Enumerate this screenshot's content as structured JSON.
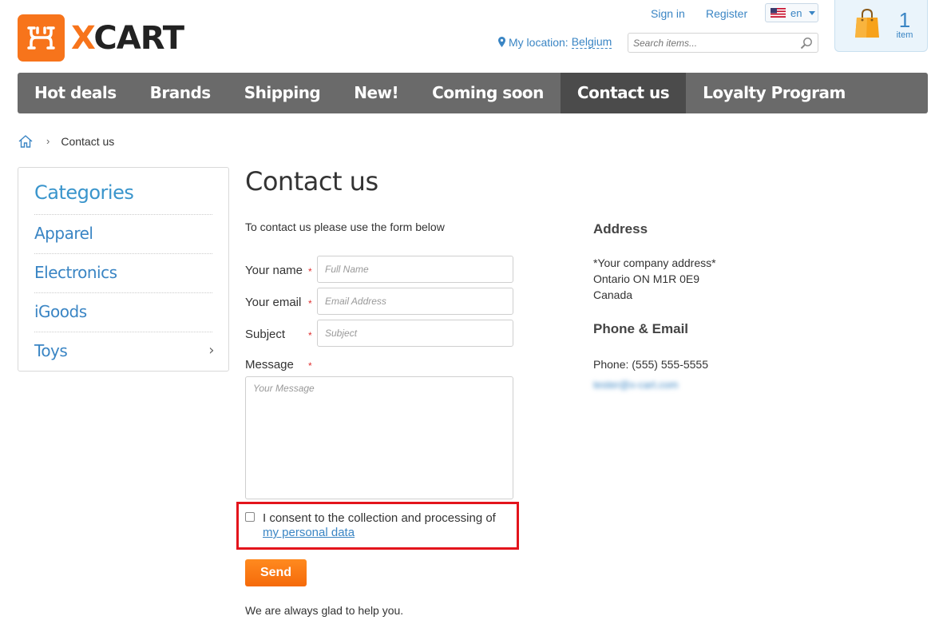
{
  "header": {
    "logo_text_x": "X",
    "logo_text_rest": "CART",
    "sign_in": "Sign in",
    "register": "Register",
    "language": "en",
    "location_label": "My location:",
    "location_value": "Belgium",
    "search_placeholder": "Search items...",
    "cart_count": "1",
    "cart_label": "item"
  },
  "nav": {
    "items": [
      "Hot deals",
      "Brands",
      "Shipping",
      "New!",
      "Coming soon",
      "Contact us",
      "Loyalty Program"
    ],
    "active": "Contact us"
  },
  "breadcrumb": {
    "separator": "›",
    "current": "Contact us"
  },
  "sidebar": {
    "title": "Categories",
    "items": [
      "Apparel",
      "Electronics",
      "iGoods",
      "Toys"
    ],
    "toys_chevron": "›"
  },
  "main": {
    "title": "Contact us",
    "intro": "To contact us please use the form below",
    "fields": {
      "name_label": "Your name",
      "name_placeholder": "Full Name",
      "email_label": "Your email",
      "email_placeholder": "Email Address",
      "subject_label": "Subject",
      "subject_placeholder": "Subject",
      "message_label": "Message",
      "message_placeholder": "Your Message",
      "required_mark": "*"
    },
    "consent_text": "I consent to the collection and processing of",
    "consent_link": "my personal data",
    "send_label": "Send",
    "footer_note": "We are always glad to help you."
  },
  "contact": {
    "address_heading": "Address",
    "address_lines": [
      "*Your company address*",
      "Ontario ON M1R 0E9",
      "Canada"
    ],
    "phone_heading": "Phone & Email",
    "phone": "Phone: (555) 555-5555",
    "email": "tester@x-cart.com"
  },
  "colors": {
    "brand_orange": "#f7741b",
    "link_blue": "#3a85c4",
    "nav_bg": "#6a6a6a",
    "nav_active": "#4b4b4b",
    "highlight_red": "#e3141c"
  }
}
